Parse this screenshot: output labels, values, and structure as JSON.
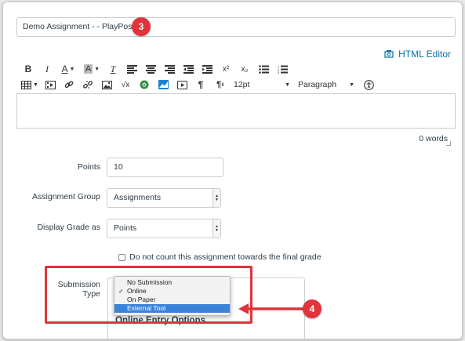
{
  "assignment": {
    "title_value": "Demo Assignment - - PlayPosit"
  },
  "callouts": {
    "step_title": "3",
    "step_submission": "4",
    "color": "#e0333c"
  },
  "editor": {
    "html_editor_label": "HTML Editor",
    "font_size": "12pt",
    "block_format": "Paragraph",
    "word_count": "0 words",
    "row1_icons": [
      "bold-icon",
      "italic-icon",
      "underline-icon",
      "text-color-icon",
      "background-color-icon",
      "clear-formatting-icon",
      "align-left-icon",
      "align-center-icon",
      "align-right-icon",
      "outdent-icon",
      "indent-icon",
      "superscript-icon",
      "subscript-icon",
      "bullet-list-icon",
      "numbered-list-icon"
    ],
    "row2_icons": [
      "table-icon",
      "media-icon",
      "link-icon",
      "unlink-icon",
      "image-icon",
      "math-equation-icon",
      "apps-icon",
      "flickr-icon",
      "video-icon",
      "paragraph-ltr-icon",
      "paragraph-rtl-icon",
      "accessibility-icon"
    ],
    "bold_glyph": "B",
    "italic_glyph": "I",
    "underline_glyph": "A",
    "bg_glyph": "A",
    "clear_glyph": "T",
    "sup_glyph": "x²",
    "sub_glyph": "x₂",
    "pilcrow_glyph": "¶",
    "pilcrow_rtl_glyph": "¶‹",
    "math_glyph": "√x"
  },
  "form": {
    "points_label": "Points",
    "points_value": "10",
    "group_label": "Assignment Group",
    "group_value": "Assignments",
    "display_label": "Display Grade as",
    "display_value": "Points",
    "final_grade_checkbox_label": "Do not count this assignment towards the final grade",
    "final_grade_checked": false,
    "submission_label": "Submission Type",
    "online_entry_heading": "Online Entry Options"
  },
  "submission_dropdown": {
    "options": [
      {
        "label": "No Submission",
        "checked": false,
        "highlighted": false
      },
      {
        "label": "Online",
        "checked": true,
        "highlighted": false
      },
      {
        "label": "On Paper",
        "checked": false,
        "highlighted": false
      },
      {
        "label": "External Tool",
        "checked": false,
        "highlighted": true
      }
    ],
    "check_glyph": "✓"
  }
}
